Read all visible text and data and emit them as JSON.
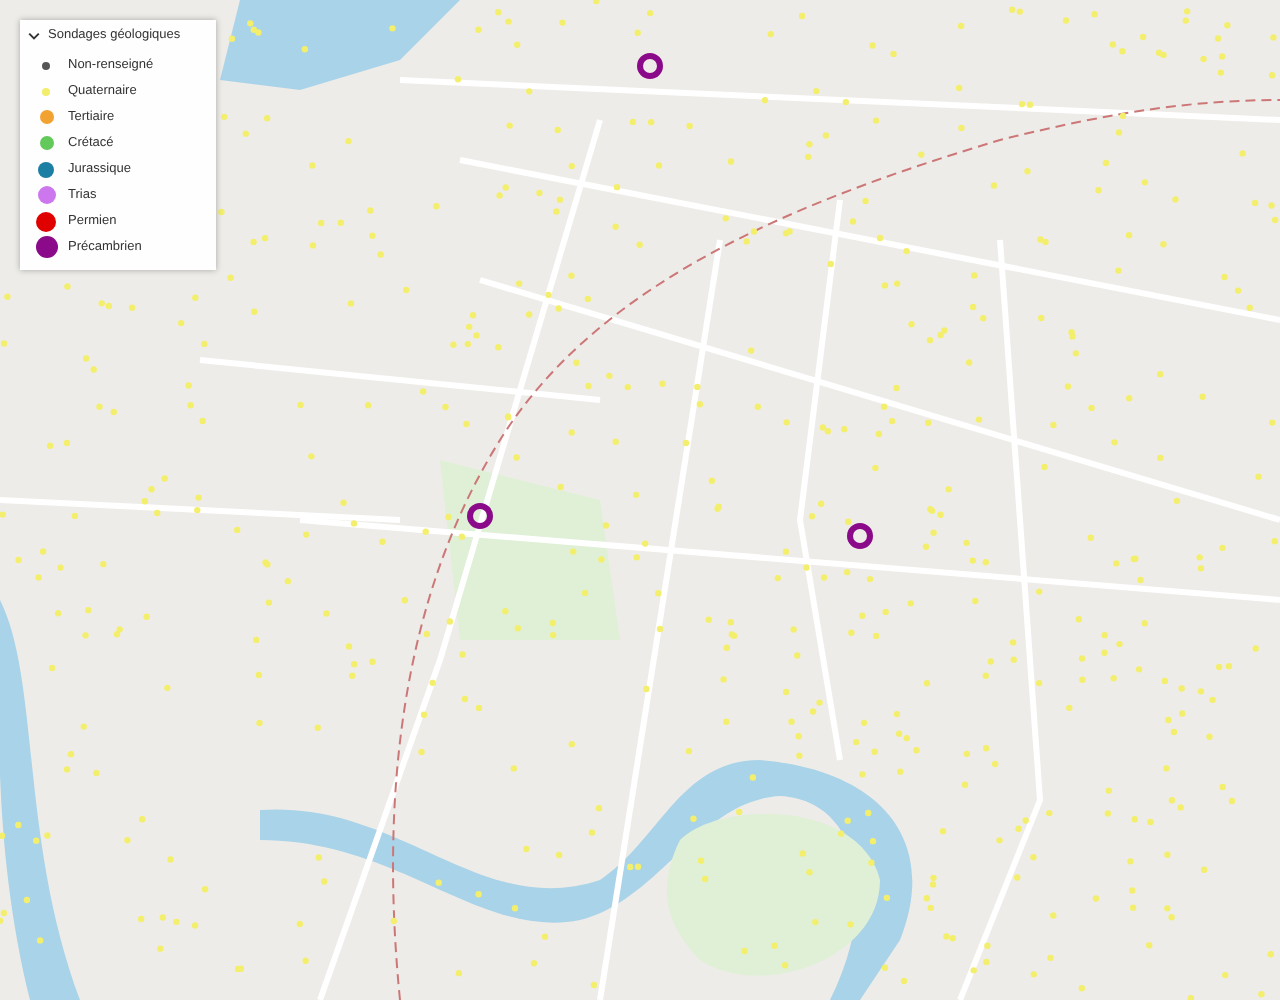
{
  "legend": {
    "title": "Sondages géologiques",
    "expanded": true,
    "items": [
      {
        "label": "Non-renseigné",
        "color": "#555555"
      },
      {
        "label": "Quaternaire",
        "color": "#f2ee6a"
      },
      {
        "label": "Tertiaire",
        "color": "#f2a230"
      },
      {
        "label": "Crétacé",
        "color": "#62c95a"
      },
      {
        "label": "Jurassique",
        "color": "#1b7fa3"
      },
      {
        "label": "Trias",
        "color": "#cc77ee"
      },
      {
        "label": "Permien",
        "color": "#e00000"
      },
      {
        "label": "Précambrien",
        "color": "#8a0a8a"
      }
    ]
  }
}
